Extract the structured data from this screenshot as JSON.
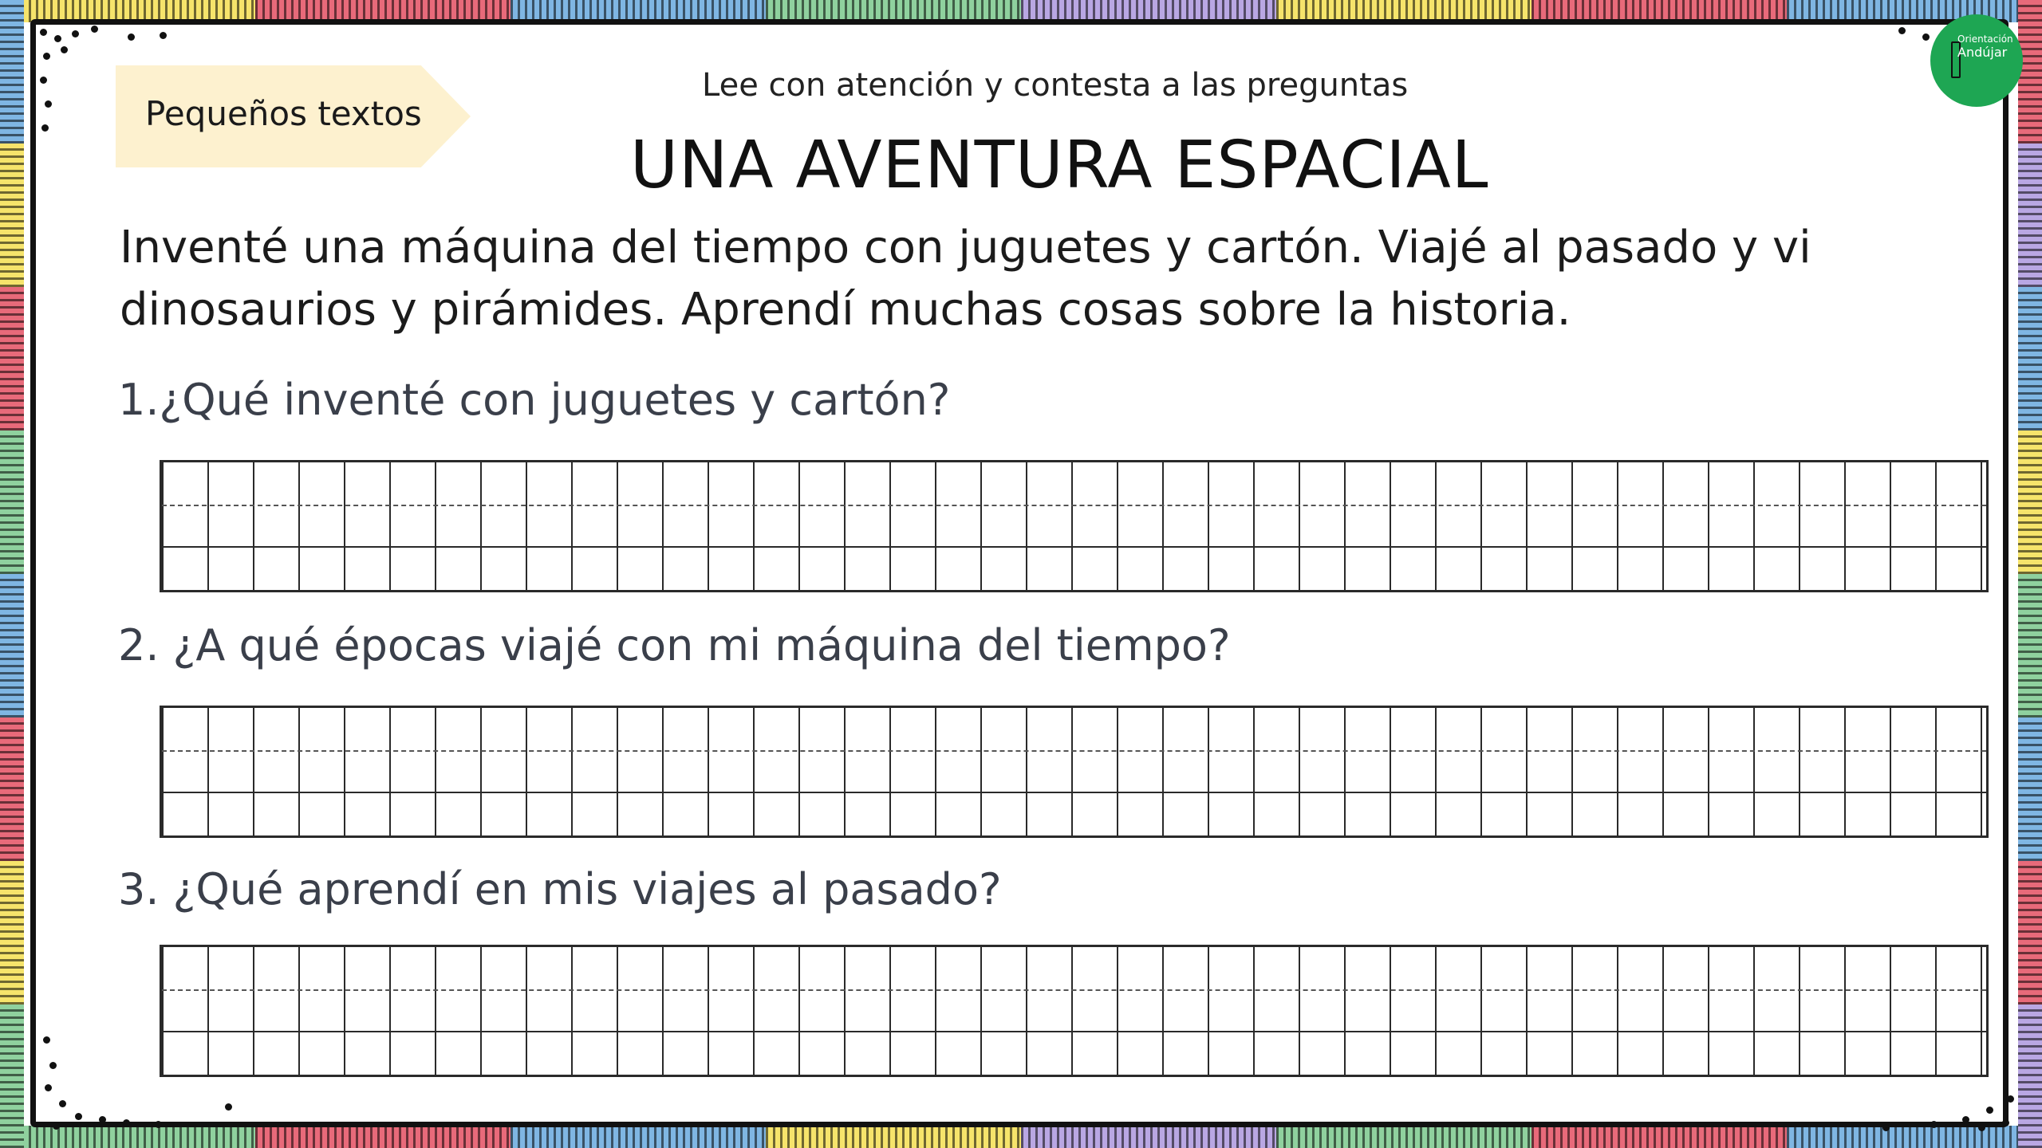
{
  "header": {
    "tag_label": "Pequeños textos",
    "instruction": "Lee con atención y contesta a las preguntas",
    "title": "UNA AVENTURA ESPACIAL",
    "logo_line1": "Orientación",
    "logo_line2": "Andújar"
  },
  "story": {
    "text": "Inventé una máquina del tiempo con juguetes y cartón. Viajé al pasado y vi dinosaurios y pirámides. Aprendí muchas cosas sobre la historia."
  },
  "questions": [
    {
      "text": "1.¿Qué inventé con juguetes y cartón?"
    },
    {
      "text": "2. ¿A qué épocas viajé con mi máquina del tiempo?"
    },
    {
      "text": "3. ¿Qué aprendí en mis viajes al pasado?"
    }
  ],
  "colors": {
    "border_segments": [
      "#f6e46b",
      "#e86a7a",
      "#7fb6e3",
      "#8fd19e",
      "#b9a7e3",
      "#f6e46b",
      "#e86a7a",
      "#7fb6e3",
      "#8fd19e",
      "#b9a7e3",
      "#f6e46b",
      "#e86a7a"
    ],
    "tag_background": "#fdf1cf",
    "logo_background": "#1ea653"
  }
}
